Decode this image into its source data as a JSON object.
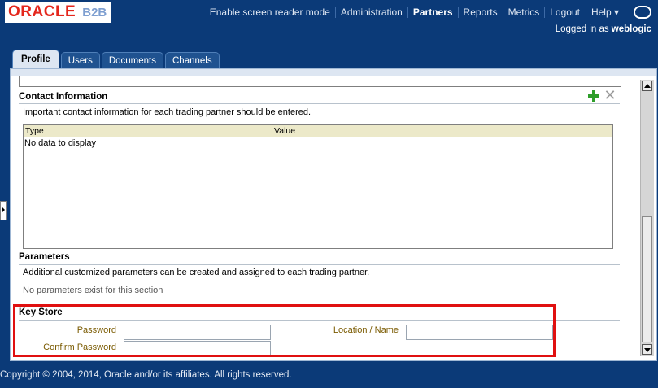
{
  "brand": {
    "oracle": "ORACLE",
    "product": "B2B"
  },
  "topnav": {
    "items": [
      "Enable screen reader mode",
      "Administration",
      "Partners",
      "Reports",
      "Metrics",
      "Logout"
    ],
    "help": "Help ▾",
    "active": "Partners"
  },
  "session": {
    "logged_prefix": "Logged in as ",
    "user": "weblogic"
  },
  "tabs": [
    "Profile",
    "Users",
    "Documents",
    "Channels"
  ],
  "contact": {
    "title": "Contact Information",
    "description": "Important contact information for each trading partner should be entered.",
    "columns": [
      "Type",
      "Value"
    ],
    "empty_text": "No data to display"
  },
  "parameters": {
    "title": "Parameters",
    "description": "Additional customized parameters can be created and assigned to each trading partner.",
    "empty_text": "No parameters exist for this section"
  },
  "keystore": {
    "title": "Key Store",
    "password_label": "Password",
    "password_value": "",
    "confirm_label": "Confirm Password",
    "confirm_value": "",
    "location_label": "Location / Name",
    "location_value": ""
  },
  "footer": {
    "copyright": "Copyright © 2004, 2014, Oracle and/or its affiliates.  All rights reserved."
  },
  "colors": {
    "header_bg": "#0b3a78",
    "logo_red": "#e4261c",
    "highlight": "#e01010",
    "add_green": "#2e9e2a"
  },
  "icons": [
    "add-icon",
    "delete-icon",
    "user-icon",
    "scroll-up-icon",
    "scroll-down-icon",
    "expand-panel-icon"
  ]
}
